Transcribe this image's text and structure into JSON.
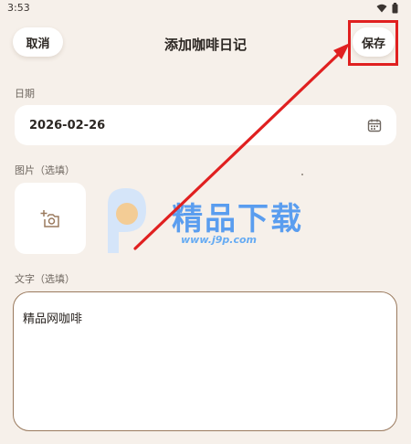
{
  "status_bar": {
    "time": "3:53"
  },
  "header": {
    "cancel_label": "取消",
    "title": "添加咖啡日记",
    "save_label": "保存"
  },
  "form": {
    "date_label": "日期",
    "date_value": "2026-02-26",
    "photo_label": "图片（选填）",
    "text_label": "文字（选填）",
    "text_value": "精品网咖啡"
  },
  "watermark": {
    "brand": "精品下载",
    "url": "www.j9p.com"
  },
  "colors": {
    "background": "#f6f0ea",
    "card": "#ffffff",
    "accent_border": "#9a7a5e",
    "annotation_red": "#e02020",
    "watermark_blue": "#3f8ff0"
  },
  "icons": [
    "wifi-icon",
    "battery-icon",
    "calendar-icon",
    "add-photo-icon"
  ]
}
